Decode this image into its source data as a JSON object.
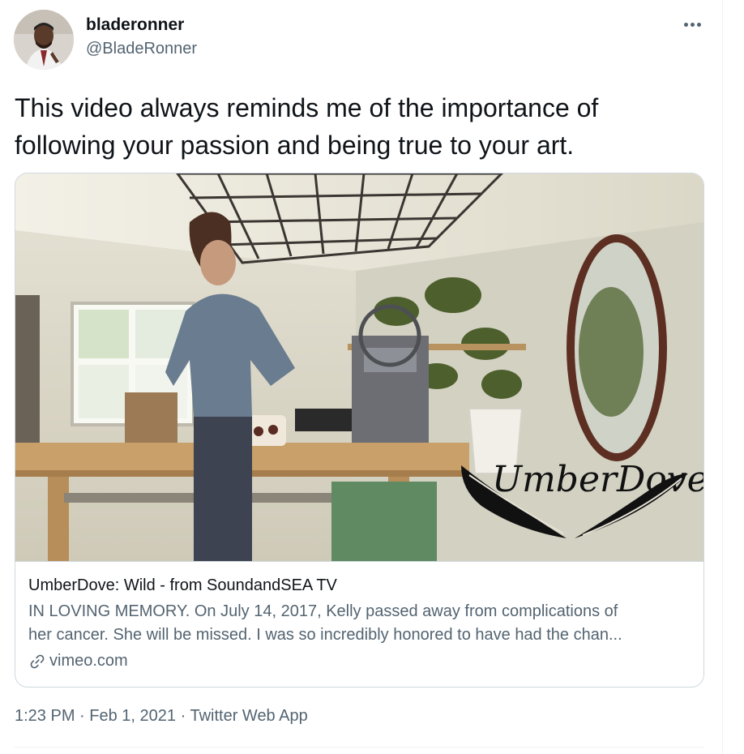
{
  "tweet": {
    "author": {
      "display_name": "bladeronner",
      "handle": "@BladeRonner"
    },
    "text": "This video always reminds me of the importance of following your passion and being true to your art.",
    "more_icon": "more-horizontal-icon",
    "card": {
      "watermark": "UmberDove",
      "title": "UmberDove: Wild - from SoundandSEA TV",
      "description_lines": [
        "IN LOVING MEMORY. On July 14, 2017, Kelly passed away from complications of",
        "her cancer. She will be missed. I was so incredibly honored to have had the chan..."
      ],
      "domain": "vimeo.com",
      "domain_icon": "link-icon"
    },
    "meta": {
      "time": "1:23 PM",
      "separator": "·",
      "date": "Feb 1, 2021",
      "source": "Twitter Web App"
    }
  },
  "colors": {
    "text_primary": "#0f1419",
    "text_secondary": "#536471",
    "border": "#cfd9de"
  }
}
